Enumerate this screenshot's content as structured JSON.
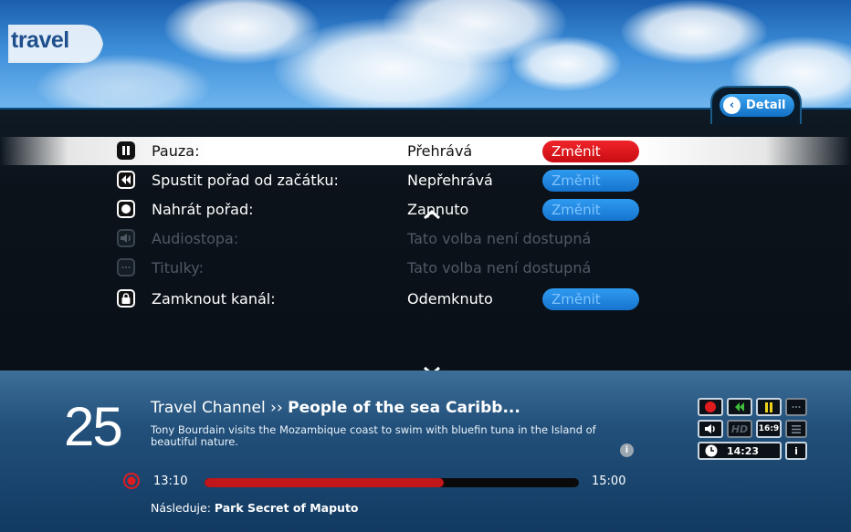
{
  "header": {
    "channel_logo": "travel",
    "detail_label": "Detail",
    "detail_icon": "chevron-left-icon"
  },
  "menu": {
    "items": [
      {
        "icon": "pause-icon",
        "label": "Pauza:",
        "value": "Přehrává",
        "action": "Změnit",
        "enabled": true,
        "selected": true
      },
      {
        "icon": "rewind-icon",
        "label": "Spustit pořad od začátku:",
        "value": "Nepřehrává",
        "action": "Změnit",
        "enabled": true,
        "selected": false
      },
      {
        "icon": "record-icon",
        "label": "Nahrát pořad:",
        "value": "Zapnuto",
        "action": "Změnit",
        "enabled": true,
        "selected": false
      },
      {
        "icon": "audio-icon",
        "label": "Audiostopa:",
        "value": "Tato volba není dostupná",
        "action": "",
        "enabled": false,
        "selected": false
      },
      {
        "icon": "subtitles-icon",
        "label": "Titulky:",
        "value": "Tato volba není dostupná",
        "action": "",
        "enabled": false,
        "selected": false
      },
      {
        "icon": "lock-icon",
        "label": "Zamknout kanál:",
        "value": "Odemknuto",
        "action": "Změnit",
        "enabled": true,
        "selected": false
      }
    ]
  },
  "info": {
    "channel_number": "25",
    "channel_name": "Travel Channel",
    "separator": "››",
    "program_title": "People of the sea Caribb...",
    "description": "Tony Bourdain visits the Mozambique coast to swim with bluefin tuna in the Island of beautiful nature.",
    "start_time": "13:10",
    "end_time": "15:00",
    "progress": 0.64,
    "next_label": "Následuje:",
    "next_program": "Park Secret of Maputo",
    "clock": "14:23",
    "status_icons": [
      "record-icon",
      "rewind-icon",
      "pause-icon",
      "subtitles-icon",
      "audio-icon",
      "hd-icon",
      "aspect-169-icon",
      "list-icon",
      "clock-icon",
      "info-icon"
    ],
    "hd_label": "HD",
    "aspect_label": "16:9",
    "info_label": "i"
  },
  "colors": {
    "accent_blue": "#1574cf",
    "accent_red": "#c80d12",
    "panel_bg": "#0b121a"
  }
}
